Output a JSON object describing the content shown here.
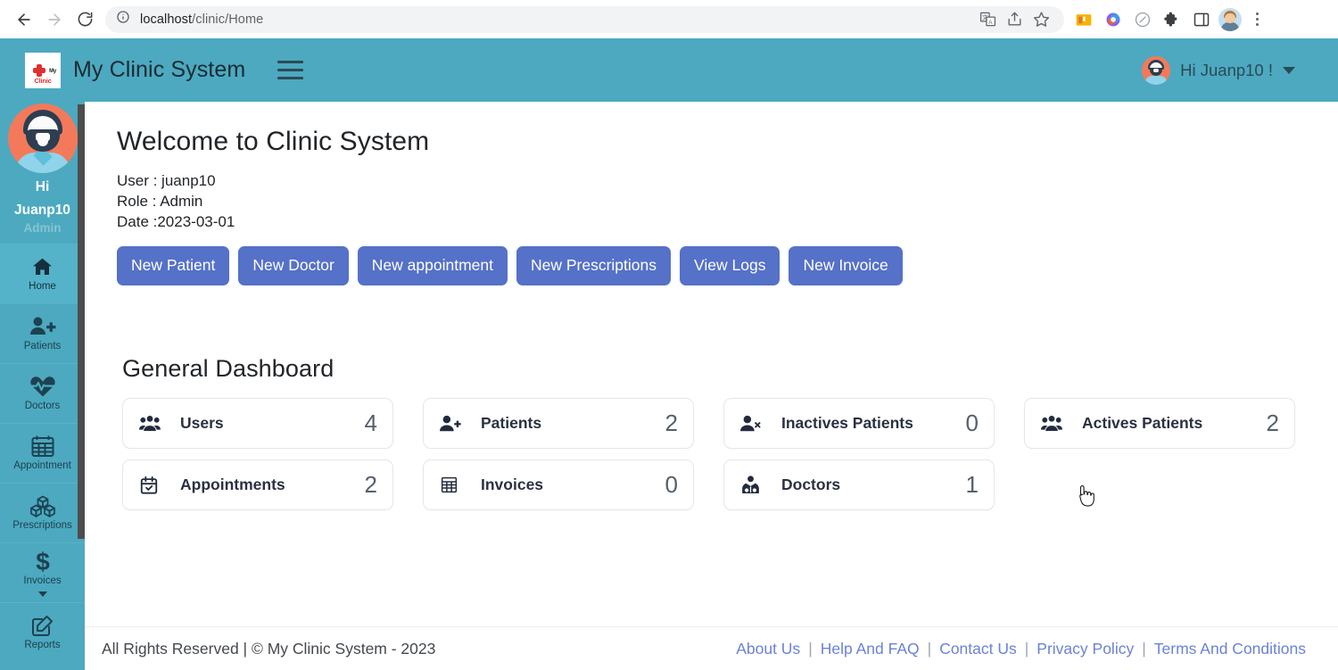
{
  "browser": {
    "url_host": "localhost",
    "url_path": "/clinic/Home",
    "back_icon": "back-arrow-icon",
    "forward_icon": "forward-arrow-icon",
    "reload_icon": "reload-icon",
    "info_icon": "site-info-icon",
    "translate_icon": "translate-icon",
    "share_icon": "share-icon",
    "bookmark_icon": "star-icon",
    "ext_icons": [
      "wallet-extension-icon",
      "copilot-extension-icon",
      "slash-circle-extension-icon",
      "puzzle-extensions-icon",
      "side-panel-icon"
    ],
    "profile_icon": "profile-avatar-icon",
    "menu_icon": "kebab-menu-icon"
  },
  "header": {
    "logo_cross_text_top": "My",
    "logo_cross_text_bottom": "Clinic",
    "title": "My Clinic System",
    "menu_toggle_icon": "hamburger-menu-icon",
    "user_greeting": "Hi Juanp10 !",
    "user_caret_icon": "chevron-down-icon"
  },
  "sidebar": {
    "greeting_line1": "Hi",
    "greeting_line2": "Juanp10",
    "role": "Admin",
    "items": [
      {
        "label": "Home",
        "icon": "home-icon",
        "active": true,
        "has_caret": false
      },
      {
        "label": "Patients",
        "icon": "user-plus-icon",
        "active": false,
        "has_caret": false
      },
      {
        "label": "Doctors",
        "icon": "heartbeat-icon",
        "active": false,
        "has_caret": false
      },
      {
        "label": "Appointment",
        "icon": "calendar-icon",
        "active": false,
        "has_caret": false
      },
      {
        "label": "Prescriptions",
        "icon": "boxes-icon",
        "active": false,
        "has_caret": false
      },
      {
        "label": "Invoices",
        "icon": "dollar-icon",
        "active": false,
        "has_caret": true
      },
      {
        "label": "Reports",
        "icon": "edit-square-icon",
        "active": false,
        "has_caret": false
      }
    ]
  },
  "main": {
    "welcome_title": "Welcome to Clinic System",
    "user_line": "User : juanp10",
    "role_line": "Role : Admin",
    "date_line": "Date :2023-03-01",
    "buttons": [
      {
        "label": "New Patient"
      },
      {
        "label": "New Doctor"
      },
      {
        "label": "New appointment"
      },
      {
        "label": "New Prescriptions"
      },
      {
        "label": "View Logs"
      },
      {
        "label": "New Invoice"
      }
    ],
    "dashboard_title": "General Dashboard",
    "cards": [
      {
        "label": "Users",
        "value": "4",
        "icon": "users-group-icon"
      },
      {
        "label": "Patients",
        "value": "2",
        "icon": "user-plus-icon"
      },
      {
        "label": "Inactives Patients",
        "value": "0",
        "icon": "user-times-icon"
      },
      {
        "label": "Actives Patients",
        "value": "2",
        "icon": "users-group-icon"
      },
      {
        "label": "Appointments",
        "value": "2",
        "icon": "calendar-check-icon"
      },
      {
        "label": "Invoices",
        "value": "0",
        "icon": "table-grid-icon"
      },
      {
        "label": "Doctors",
        "value": "1",
        "icon": "doctor-icon"
      }
    ]
  },
  "footer": {
    "copyright": "All Rights Reserved | © My Clinic System - 2023",
    "links": [
      "About Us",
      "Help And FAQ",
      "Contact Us",
      "Privacy Policy",
      "Terms And Conditions"
    ],
    "separator": "|"
  },
  "colors": {
    "brand_teal": "#4ca9c0",
    "button_blue": "#5571c8",
    "link_blue": "#6b82d6",
    "card_value": "#55606e"
  }
}
